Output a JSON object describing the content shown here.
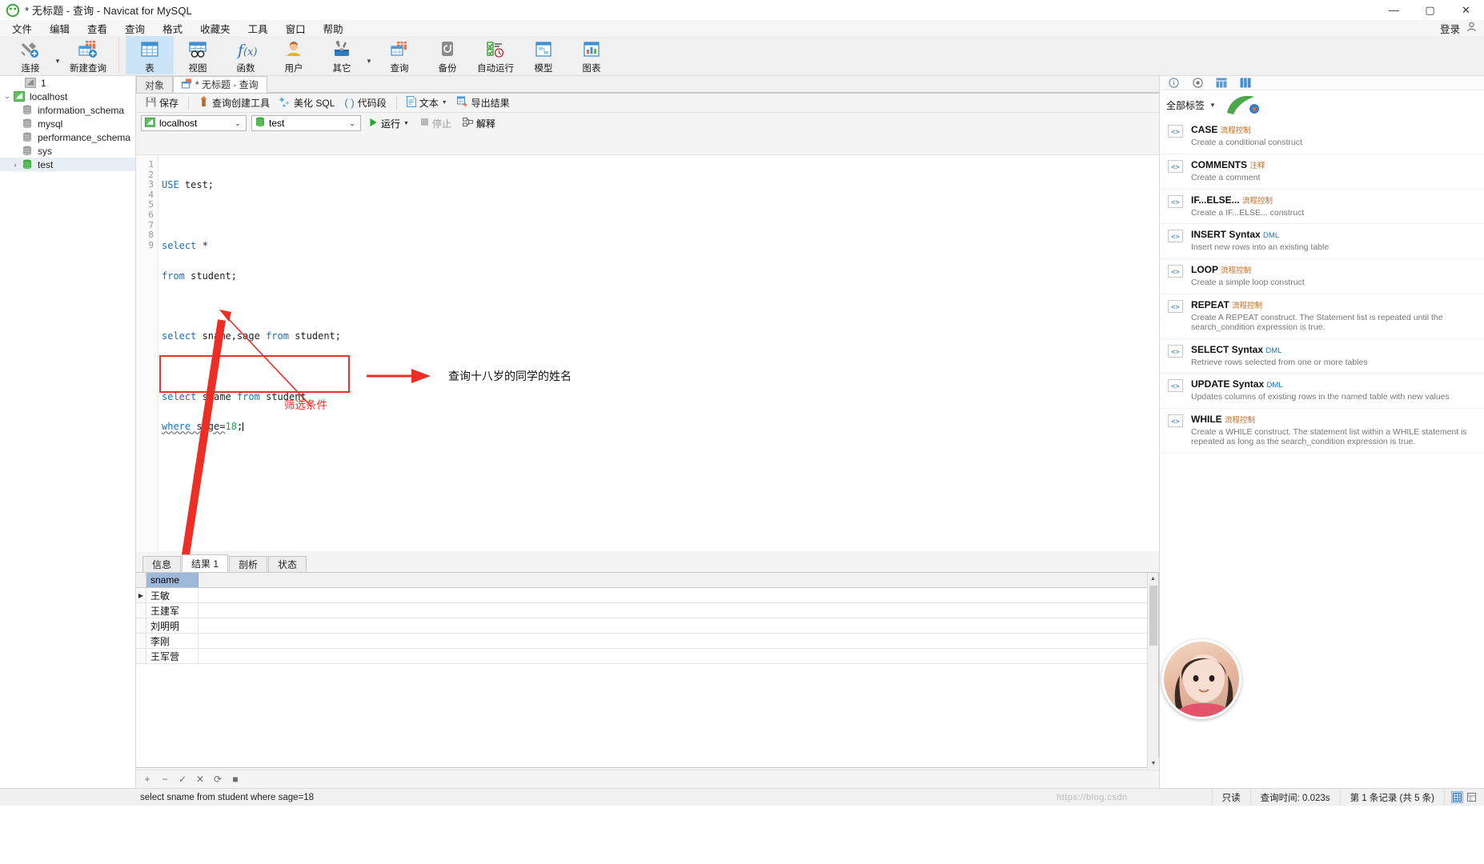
{
  "window": {
    "title": "* 无标题 - 查询 - Navicat for MySQL",
    "minimize": "—",
    "maximize": "▢",
    "close": "✕"
  },
  "menubar": {
    "items": [
      "文件",
      "编辑",
      "查看",
      "查询",
      "格式",
      "收藏夹",
      "工具",
      "窗口",
      "帮助"
    ],
    "login_label": "登录"
  },
  "ribbon": {
    "buttons": [
      {
        "label": "连接",
        "icon": "connection-icon",
        "caret": true
      },
      {
        "label": "新建查询",
        "icon": "new-query-icon",
        "caret": false
      },
      {
        "label": "表",
        "icon": "table-icon",
        "caret": false,
        "active": true
      },
      {
        "label": "视图",
        "icon": "view-icon",
        "caret": false
      },
      {
        "label": "函数",
        "icon": "function-icon",
        "caret": false
      },
      {
        "label": "用户",
        "icon": "user-icon",
        "caret": false
      },
      {
        "label": "其它",
        "icon": "other-tools-icon",
        "caret": true
      },
      {
        "label": "查询",
        "icon": "query-icon",
        "caret": false
      },
      {
        "label": "备份",
        "icon": "backup-icon",
        "caret": false
      },
      {
        "label": "自动运行",
        "icon": "autorun-icon",
        "caret": false
      },
      {
        "label": "模型",
        "icon": "model-icon",
        "caret": false
      },
      {
        "label": "图表",
        "icon": "chart-icon",
        "caret": false
      }
    ]
  },
  "tree": {
    "items": [
      {
        "label": "1",
        "level": 0,
        "icon": "connection-gray-icon",
        "twisty": "",
        "selected": false
      },
      {
        "label": "localhost",
        "level": 0,
        "icon": "connection-green-icon",
        "twisty": "⌄",
        "selected": false
      },
      {
        "label": "information_schema",
        "level": 1,
        "icon": "database-icon",
        "twisty": "",
        "selected": false
      },
      {
        "label": "mysql",
        "level": 1,
        "icon": "database-icon",
        "twisty": "",
        "selected": false
      },
      {
        "label": "performance_schema",
        "level": 1,
        "icon": "database-icon",
        "twisty": "",
        "selected": false
      },
      {
        "label": "sys",
        "level": 1,
        "icon": "database-icon",
        "twisty": "",
        "selected": false
      },
      {
        "label": "test",
        "level": 1,
        "icon": "database-green-icon",
        "twisty": "›",
        "selected": true
      }
    ]
  },
  "doctabs": {
    "object_tab": "对象",
    "query_tab": "* 无标题 - 查询"
  },
  "sqltoolbar": {
    "save": "保存",
    "query_builder": "查询创建工具",
    "beautify_sql": "美化 SQL",
    "snippet": "代码段",
    "text": "文本",
    "export_result": "导出结果"
  },
  "connbar": {
    "connection": "localhost",
    "database": "test",
    "run": "运行",
    "stop": "停止",
    "explain": "解释"
  },
  "editor": {
    "line_numbers": [
      "1",
      "2",
      "3",
      "4",
      "5",
      "6",
      "7",
      "8",
      "9"
    ],
    "lines": [
      [
        {
          "t": "USE",
          "c": "kw"
        },
        {
          "t": " test;",
          "c": "plain"
        }
      ],
      [],
      [
        {
          "t": "select",
          "c": "kw"
        },
        {
          "t": " *",
          "c": "plain"
        }
      ],
      [
        {
          "t": "from",
          "c": "kw"
        },
        {
          "t": " student;",
          "c": "plain"
        }
      ],
      [],
      [
        {
          "t": "select",
          "c": "kw"
        },
        {
          "t": " sname,sage ",
          "c": "plain"
        },
        {
          "t": "from",
          "c": "kw"
        },
        {
          "t": " student;",
          "c": "plain"
        }
      ],
      [],
      [
        {
          "t": "select",
          "c": "kw"
        },
        {
          "t": " sname ",
          "c": "plain"
        },
        {
          "t": "from",
          "c": "kw"
        },
        {
          "t": " student",
          "c": "plain"
        }
      ],
      [
        {
          "t": "where",
          "c": "kw wavy"
        },
        {
          "t": " sage=",
          "c": "plain wavy"
        },
        {
          "t": "18",
          "c": "num"
        },
        {
          "t": ";",
          "c": "plain"
        }
      ]
    ]
  },
  "annotations": {
    "query_label": "查询十八岁的同学的姓名",
    "filter_label": "筛选条件"
  },
  "results": {
    "tabs": [
      {
        "label": "信息",
        "active": false
      },
      {
        "label": "结果 1",
        "active": true
      },
      {
        "label": "剖析",
        "active": false
      },
      {
        "label": "状态",
        "active": false
      }
    ],
    "columns": [
      "sname"
    ],
    "rows": [
      {
        "marker": "▶",
        "sname": "王敏"
      },
      {
        "marker": "",
        "sname": "王建军"
      },
      {
        "marker": "",
        "sname": "刘明明"
      },
      {
        "marker": "",
        "sname": "李刚"
      },
      {
        "marker": "",
        "sname": "王军营"
      }
    ],
    "footer_buttons": [
      "+",
      "−",
      "✓",
      "✕",
      "⟳",
      "■"
    ]
  },
  "rightpanel": {
    "toolbar_icons": [
      "info-icon",
      "record-icon",
      "history-icon",
      "snippet-panel-icon"
    ],
    "all_tags_label": "全部标签",
    "snippets": [
      {
        "title": "CASE",
        "category": "流程控制",
        "cat_color": "orange",
        "desc": "Create a conditional construct"
      },
      {
        "title": "COMMENTS",
        "category": "注释",
        "cat_color": "orange",
        "desc": "Create a comment"
      },
      {
        "title": "IF...ELSE...",
        "category": "流程控制",
        "cat_color": "orange",
        "desc": "Create a IF...ELSE... construct"
      },
      {
        "title": "INSERT Syntax",
        "category": "DML",
        "cat_color": "blue",
        "desc": "Insert new rows into an existing table"
      },
      {
        "title": "LOOP",
        "category": "流程控制",
        "cat_color": "orange",
        "desc": "Create a simple loop construct"
      },
      {
        "title": "REPEAT",
        "category": "流程控制",
        "cat_color": "orange",
        "desc": "Create A REPEAT construct. The Statement list is repeated until the search_condition expression is true."
      },
      {
        "title": "SELECT Syntax",
        "category": "DML",
        "cat_color": "blue",
        "desc": "Retrieve rows selected from one or more tables"
      },
      {
        "title": "UPDATE Syntax",
        "category": "DML",
        "cat_color": "blue",
        "desc": "Updates columns of existing rows in the named table with new values"
      },
      {
        "title": "WHILE",
        "category": "流程控制",
        "cat_color": "orange",
        "desc": "Create a WHILE construct. The statement list within a WHILE statement is repeated as long as the search_condition expression is true."
      }
    ]
  },
  "statusbar": {
    "sql": "select sname from student where sage=18",
    "readonly": "只读",
    "query_time": "查询时间: 0.023s",
    "record_info": "第 1 条记录 (共 5 条)",
    "watermark": "https://blog.csdn"
  }
}
